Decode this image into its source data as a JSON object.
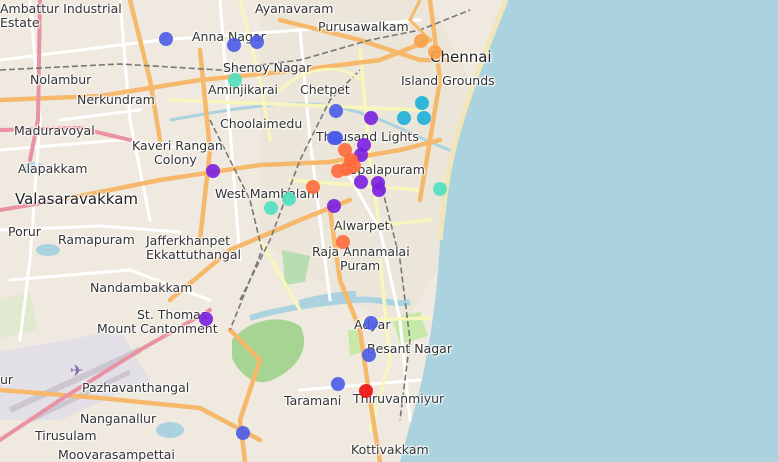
{
  "map": {
    "labels": {
      "ambattur": [
        "Ambattur Industrial",
        "Estate"
      ],
      "anna_nagar": "Anna Nagar",
      "ayanavaram": "Ayanavaram",
      "purusawalkam": "Purusawalkam",
      "chennai": "Chennai",
      "shenoy_nagar": "Shenoy Nagar",
      "nolambur": "Nolambur",
      "aminjikarai": "Aminjikarai",
      "island_grounds": "Island Grounds",
      "nerkundram": "Nerkundram",
      "chetpet": "Chetpet",
      "maduravoyal": "Maduravoyal",
      "choolaimedu": "Choolaimedu",
      "thousand_lights": "Thousand Lights",
      "kaveri": [
        "Kaveri Rangan",
        "Colony"
      ],
      "alapakkam": "Alapakkam",
      "gopalapuram": "Gopalapuram",
      "west_mambalam": "West Mambalam",
      "valasaravakkam": "Valasaravakkam",
      "porur": "Porur",
      "alwarpet": "Alwarpet",
      "ramapuram": "Ramapuram",
      "jafferkhanpet": [
        "Jafferkhanpet",
        "Ekkattuthangal"
      ],
      "raja_annamalai": [
        "Raja Annamalai",
        "Puram"
      ],
      "nandambakkam": "Nandambakkam",
      "st_thomas": [
        "St. Thomas",
        "Mount Cantonment"
      ],
      "adyar": "Adyar",
      "besant_nagar": "Besant Nagar",
      "ur": "ur",
      "pazhavanthangal": "Pazhavanthangal",
      "taramani": "Taramani",
      "thiruvanmiyur": "Thiruvanmiyur",
      "nanganallur": "Nanganallur",
      "tirusulam": "Tirusulam",
      "moovarasampettai": "Moovarasampettai",
      "kottivakkam": "Kottivakkam"
    },
    "marker_colors": {
      "blue": "#4a5be8",
      "purple": "#7a1fe0",
      "cyan": "#1cb0d8",
      "turquoise": "#4fe0c0",
      "orange": "#ff6a3c",
      "lightorange": "#f8a048",
      "red": "#ee1111"
    },
    "markers": [
      {
        "color": "blue"
      },
      {
        "color": "blue"
      },
      {
        "color": "blue"
      },
      {
        "color": "blue"
      },
      {
        "color": "blue"
      },
      {
        "color": "blue"
      },
      {
        "color": "blue"
      },
      {
        "color": "blue"
      },
      {
        "color": "blue"
      },
      {
        "color": "blue"
      },
      {
        "color": "lightorange"
      },
      {
        "color": "lightorange"
      },
      {
        "color": "turquoise"
      },
      {
        "color": "turquoise"
      },
      {
        "color": "turquoise"
      },
      {
        "color": "turquoise"
      },
      {
        "color": "cyan"
      },
      {
        "color": "cyan"
      },
      {
        "color": "cyan"
      },
      {
        "color": "purple"
      },
      {
        "color": "purple"
      },
      {
        "color": "purple"
      },
      {
        "color": "purple"
      },
      {
        "color": "purple"
      },
      {
        "color": "purple"
      },
      {
        "color": "purple"
      },
      {
        "color": "purple"
      },
      {
        "color": "purple"
      },
      {
        "color": "orange"
      },
      {
        "color": "orange"
      },
      {
        "color": "orange"
      },
      {
        "color": "orange"
      },
      {
        "color": "orange"
      },
      {
        "color": "orange"
      },
      {
        "color": "orange"
      },
      {
        "color": "red"
      }
    ]
  }
}
